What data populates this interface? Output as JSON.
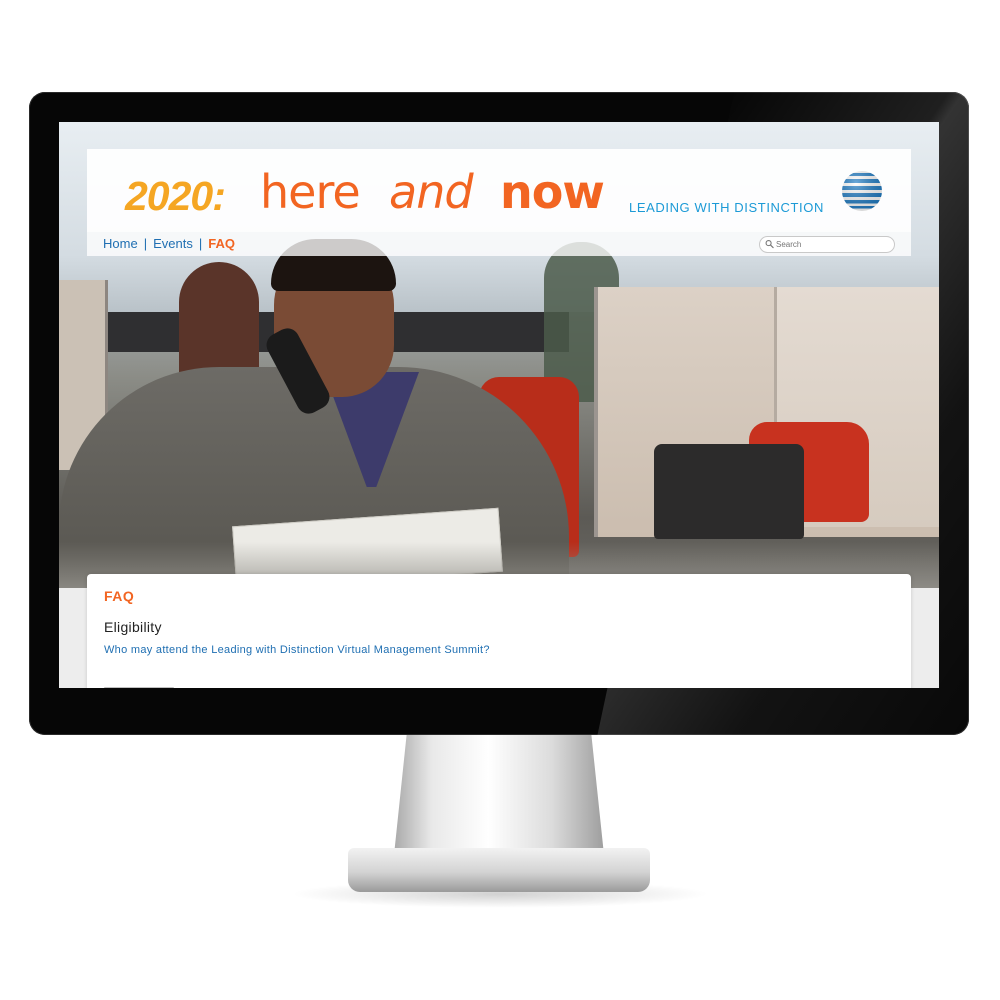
{
  "header": {
    "logo_year": "2020:",
    "logo_here": "here",
    "logo_and": "and",
    "logo_now": "now",
    "tagline": "LEADING WITH DISTINCTION",
    "brand_icon": "att-globe-icon"
  },
  "nav": {
    "items": [
      {
        "label": "Home",
        "active": false
      },
      {
        "label": "Events",
        "active": false
      },
      {
        "label": "FAQ",
        "active": true
      }
    ],
    "separator": "|"
  },
  "search": {
    "placeholder": "Search",
    "value": "",
    "icon": "search-icon"
  },
  "content": {
    "page_title": "FAQ",
    "section_title": "Eligibility",
    "question": "Who may attend the Leading with Distinction Virtual Management Summit?"
  },
  "colors": {
    "accent_orange": "#f26522",
    "accent_yellow": "#f5a623",
    "link_blue": "#1f6fb2",
    "tagline_blue": "#1c9ad6"
  }
}
